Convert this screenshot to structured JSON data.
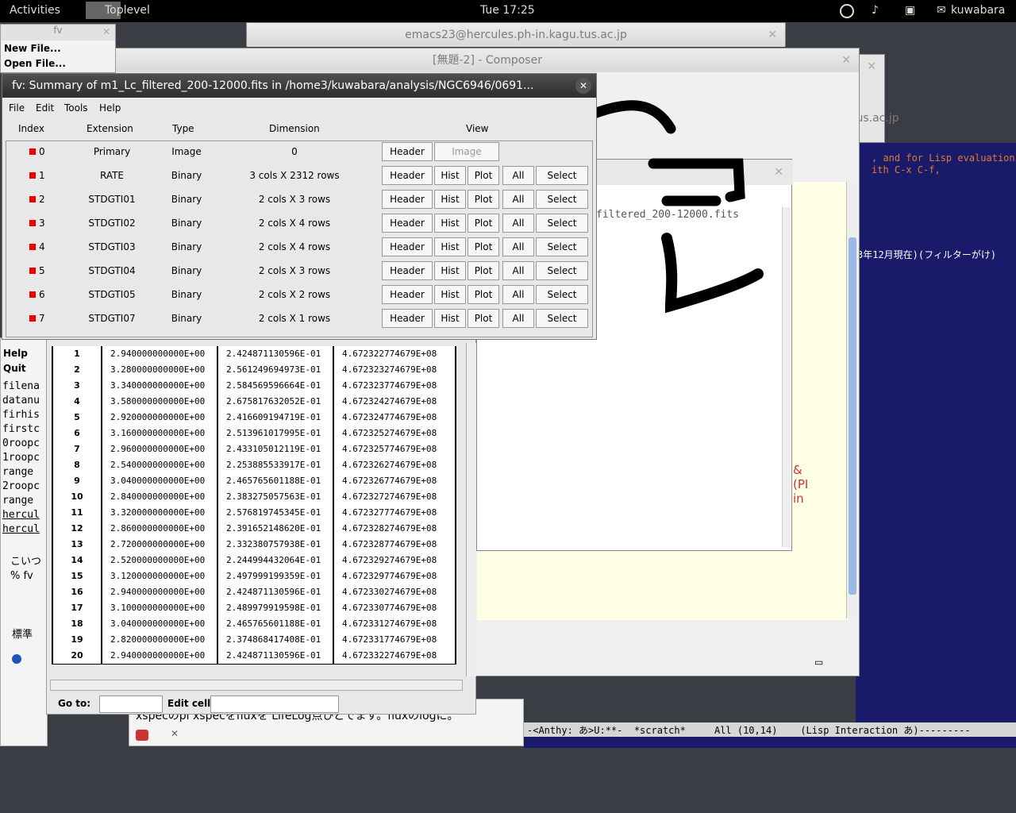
{
  "topbar": {
    "activities": "Activities",
    "app": "Toplevel",
    "clock": "Tue 17:25",
    "user": "kuwabara"
  },
  "fv_left": {
    "title": "fv",
    "items": [
      "New File...",
      "Open File..."
    ],
    "lower_items": [
      "Help",
      "Quit"
    ],
    "text_lines": [
      "filena",
      "datanu",
      "firhis",
      "firstc",
      "0roopc",
      "1roopc",
      " range",
      "2roopc",
      " range",
      "hercul",
      "hercul"
    ]
  },
  "emacs_title": "emacs23@hercules.ph-in.kagu.tus.ac.jp",
  "composer_title": "[無題-2] - Composer",
  "browser_tab": "tus.ac.jp",
  "emacs": {
    "line1": ", and for Lisp evaluation",
    "line2": "ith C-x C-f,",
    "line3": "3年12月現在)(フィルターがけ)",
    "modeline": "-<Anthy: あ>U:**-  *scratch*     All (10,14)    (Lisp Interaction あ)---------",
    "pi_text": "&(PI in"
  },
  "composer": {
    "filename_text": "filtered_200-12000.fits",
    "bottom_text": "xspecのpl xspecをfluxを LifeLog点ひとでます。fluxのlogに。",
    "left_text1": "こいつ",
    "left_text2": "% fv",
    "left_tab": "標準"
  },
  "fv_summary": {
    "title": "fv: Summary of m1_Lc_filtered_200-12000.fits in /home3/kuwabara/analysis/NGC6946/0691...",
    "menu": [
      "File",
      "Edit",
      "Tools",
      "Help"
    ],
    "headers": {
      "index": "Index",
      "extension": "Extension",
      "type": "Type",
      "dimension": "Dimension",
      "view": "View"
    },
    "rows": [
      {
        "index": "0",
        "ext": "Primary",
        "type": "Image",
        "dim": "0",
        "buttons": [
          "Header",
          "Image"
        ]
      },
      {
        "index": "1",
        "ext": "RATE",
        "type": "Binary",
        "dim": "3 cols X 2312 rows",
        "buttons": [
          "Header",
          "Hist",
          "Plot",
          "All",
          "Select"
        ]
      },
      {
        "index": "2",
        "ext": "STDGTI01",
        "type": "Binary",
        "dim": "2 cols X 3 rows",
        "buttons": [
          "Header",
          "Hist",
          "Plot",
          "All",
          "Select"
        ]
      },
      {
        "index": "3",
        "ext": "STDGTI02",
        "type": "Binary",
        "dim": "2 cols X 4 rows",
        "buttons": [
          "Header",
          "Hist",
          "Plot",
          "All",
          "Select"
        ]
      },
      {
        "index": "4",
        "ext": "STDGTI03",
        "type": "Binary",
        "dim": "2 cols X 4 rows",
        "buttons": [
          "Header",
          "Hist",
          "Plot",
          "All",
          "Select"
        ]
      },
      {
        "index": "5",
        "ext": "STDGTI04",
        "type": "Binary",
        "dim": "2 cols X 3 rows",
        "buttons": [
          "Header",
          "Hist",
          "Plot",
          "All",
          "Select"
        ]
      },
      {
        "index": "6",
        "ext": "STDGTI05",
        "type": "Binary",
        "dim": "2 cols X 2 rows",
        "buttons": [
          "Header",
          "Hist",
          "Plot",
          "All",
          "Select"
        ]
      },
      {
        "index": "7",
        "ext": "STDGTI07",
        "type": "Binary",
        "dim": "2 cols X 1 rows",
        "buttons": [
          "Header",
          "Hist",
          "Plot",
          "All",
          "Select"
        ]
      }
    ]
  },
  "table": {
    "rows": [
      [
        "1",
        "2.940000000000E+00",
        "2.424871130596E-01",
        "4.672322774679E+08"
      ],
      [
        "2",
        "3.280000000000E+00",
        "2.561249694973E-01",
        "4.672323274679E+08"
      ],
      [
        "3",
        "3.340000000000E+00",
        "2.584569596664E-01",
        "4.672323774679E+08"
      ],
      [
        "4",
        "3.580000000000E+00",
        "2.675817632052E-01",
        "4.672324274679E+08"
      ],
      [
        "5",
        "2.920000000000E+00",
        "2.416609194719E-01",
        "4.672324774679E+08"
      ],
      [
        "6",
        "3.160000000000E+00",
        "2.513961017995E-01",
        "4.672325274679E+08"
      ],
      [
        "7",
        "2.960000000000E+00",
        "2.433105012119E-01",
        "4.672325774679E+08"
      ],
      [
        "8",
        "2.540000000000E+00",
        "2.253885533917E-01",
        "4.672326274679E+08"
      ],
      [
        "9",
        "3.040000000000E+00",
        "2.465765601188E-01",
        "4.672326774679E+08"
      ],
      [
        "10",
        "2.840000000000E+00",
        "2.383275057563E-01",
        "4.672327274679E+08"
      ],
      [
        "11",
        "3.320000000000E+00",
        "2.576819745345E-01",
        "4.672327774679E+08"
      ],
      [
        "12",
        "2.860000000000E+00",
        "2.391652148620E-01",
        "4.672328274679E+08"
      ],
      [
        "13",
        "2.720000000000E+00",
        "2.332380757938E-01",
        "4.672328774679E+08"
      ],
      [
        "14",
        "2.520000000000E+00",
        "2.244994432064E-01",
        "4.672329274679E+08"
      ],
      [
        "15",
        "3.120000000000E+00",
        "2.497999199359E-01",
        "4.672329774679E+08"
      ],
      [
        "16",
        "2.940000000000E+00",
        "2.424871130596E-01",
        "4.672330274679E+08"
      ],
      [
        "17",
        "3.100000000000E+00",
        "2.489979919598E-01",
        "4.672330774679E+08"
      ],
      [
        "18",
        "3.040000000000E+00",
        "2.465765601188E-01",
        "4.672331274679E+08"
      ],
      [
        "19",
        "2.820000000000E+00",
        "2.374868417408E-01",
        "4.672331774679E+08"
      ],
      [
        "20",
        "2.940000000000E+00",
        "2.424871130596E-01",
        "4.672332274679E+08"
      ]
    ],
    "goto_label": "Go to:",
    "editcell_label": "Edit cell:",
    "goto_value": "",
    "editcell_value": ""
  },
  "colors": {
    "emacs_bg": "#1a1a6a",
    "emacs_text": "#e07a30",
    "fv_title_bg": "#3a3a3a",
    "index_marker": "#e00000",
    "composer_bg": "#ffffe6"
  }
}
